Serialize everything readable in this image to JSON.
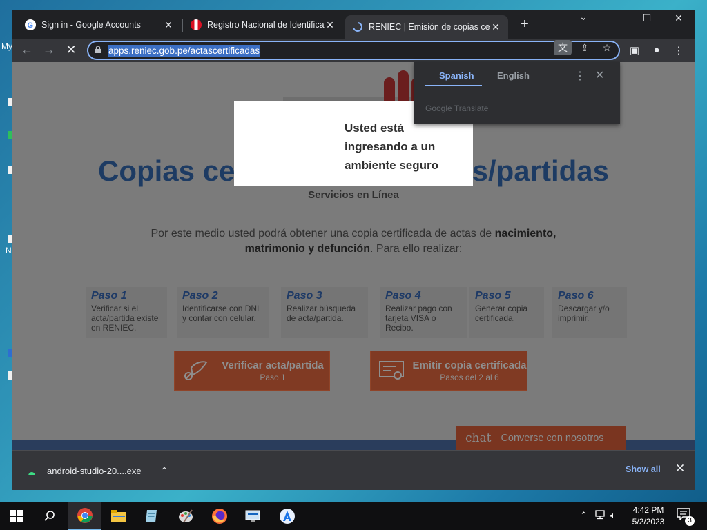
{
  "desktop": {
    "label_my": "My",
    "label_n": "N"
  },
  "browser": {
    "tabs": [
      {
        "title": "Sign in - Google Accounts",
        "favicon": "google-icon",
        "active": false
      },
      {
        "title": "Registro Nacional de Identificació",
        "favicon": "peru-flag-icon",
        "active": false
      },
      {
        "title": "RENIEC | Emisión de copias certifi",
        "favicon": "loading-spinner-icon",
        "active": true
      }
    ],
    "new_tab_label": "+",
    "url": "apps.reniec.gob.pe/actascertificadas"
  },
  "translate_popup": {
    "tab_source": "Spanish",
    "tab_target": "English",
    "brand": "Google Translate"
  },
  "secure_modal": {
    "line1": "Usted está",
    "line2": "ingresando a un",
    "line3": "ambiente seguro"
  },
  "page": {
    "title": "Copias certificadas de actas/partidas",
    "subtitle": "Servicios en Línea",
    "intro_text": "Por este medio usted podrá obtener una copia certificada de actas de",
    "intro_bold": "nacimiento, matrimonio y defunción",
    "intro_tail": ". Para ello realizar:",
    "steps": [
      {
        "title": "Paso 1",
        "desc": "Verificar si el acta/partida existe en RENIEC."
      },
      {
        "title": "Paso 2",
        "desc": "Identificarse con DNI y contar con celular."
      },
      {
        "title": "Paso 3",
        "desc": "Realizar búsqueda de acta/partida."
      },
      {
        "title": "Paso 4",
        "desc": "Realizar pago con tarjeta VISA o Recibo."
      },
      {
        "title": "Paso 5",
        "desc": "Generar copia certificada."
      },
      {
        "title": "Paso 6",
        "desc": "Descargar y/o imprimir."
      }
    ],
    "cta_verify": {
      "label": "Verificar acta/partida",
      "sub": "Paso 1"
    },
    "cta_emit": {
      "label": "Emitir copia certificada",
      "sub": "Pasos del 2 al 6"
    },
    "chat": {
      "word": "chat",
      "label": "Converse con nosotros"
    }
  },
  "downloads": {
    "file_name": "android-studio-20....exe",
    "show_all": "Show all"
  },
  "taskbar": {
    "time": "4:42 PM",
    "date": "5/2/2023",
    "notifications": "3"
  }
}
